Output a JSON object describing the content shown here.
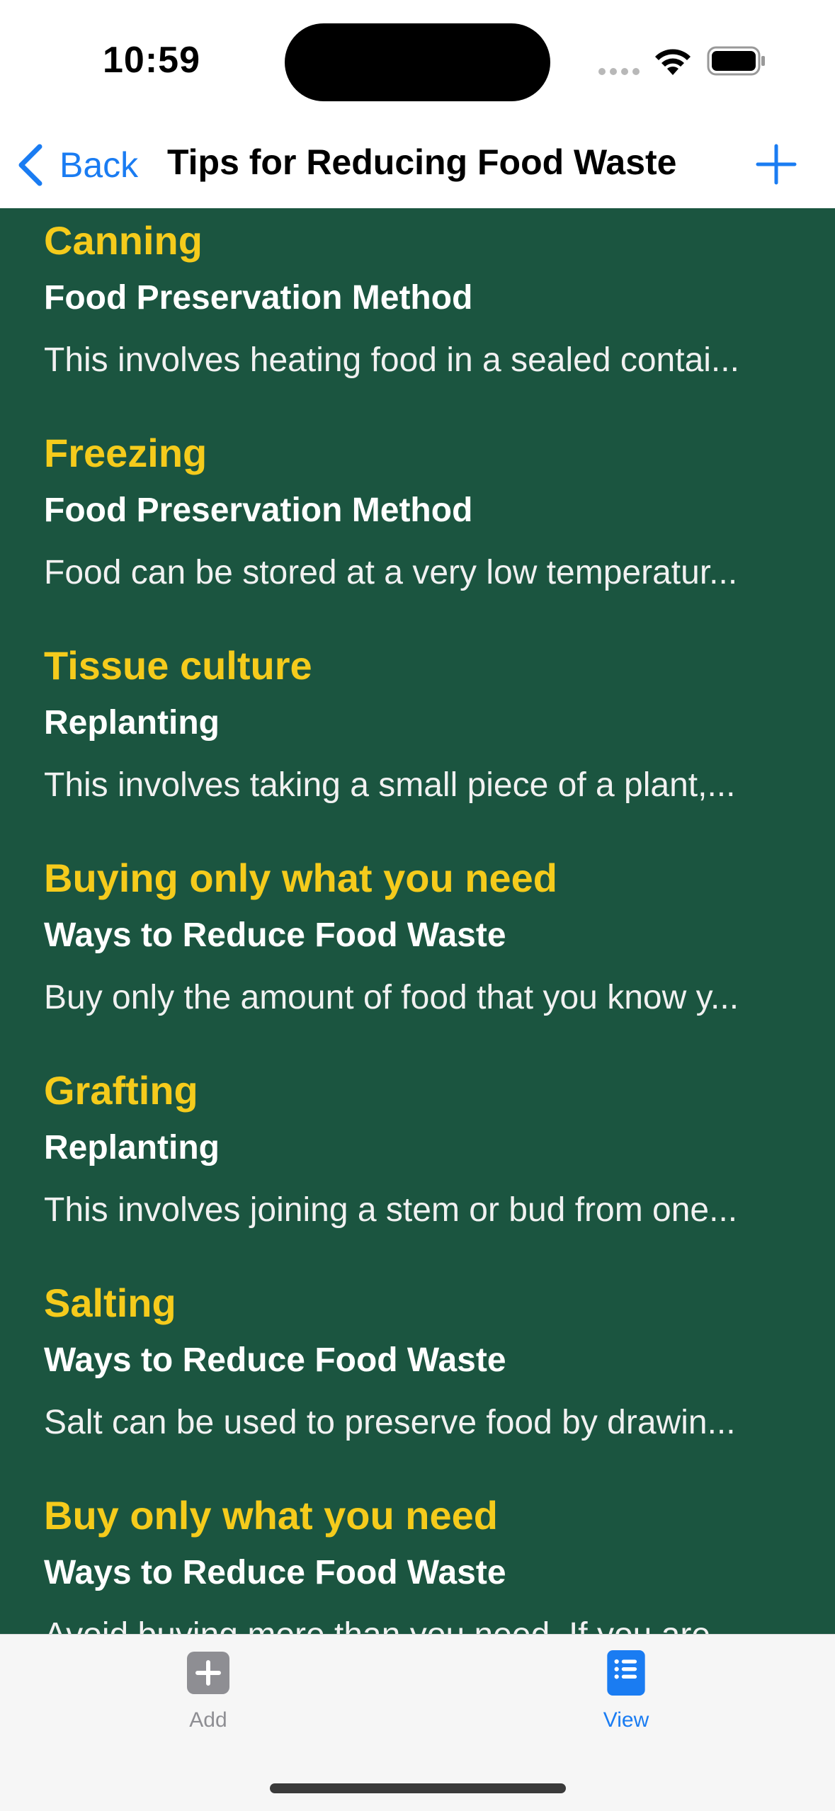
{
  "status_bar": {
    "time": "10:59"
  },
  "nav": {
    "back_label": "Back",
    "title": "Tips for Reducing Food Waste",
    "accent_color": "#1a7cf2"
  },
  "theme": {
    "background": "#1b5540",
    "title_color": "#f5cb1c",
    "text_color": "#ffffff"
  },
  "tips": [
    {
      "title": "Canning",
      "category": "Food Preservation Method",
      "description": "This involves heating food in a sealed contai..."
    },
    {
      "title": "Freezing",
      "category": "Food Preservation Method",
      "description": "Food can be stored at a very low temperatur..."
    },
    {
      "title": "Tissue culture",
      "category": "Replanting",
      "description": "This involves taking a small piece of a plant,..."
    },
    {
      "title": "Buying only what you need",
      "category": "Ways to Reduce Food Waste",
      "description": "Buy only the amount of food that you know y..."
    },
    {
      "title": "Grafting",
      "category": "Replanting",
      "description": "This involves joining a stem or bud from one..."
    },
    {
      "title": "Salting",
      "category": "Ways to Reduce Food Waste",
      "description": "Salt can be used to preserve food by drawin..."
    },
    {
      "title": "Buy only what you need",
      "category": "Ways to Reduce Food Waste",
      "description": "Avoid buying more than you need. If you are..."
    }
  ],
  "tab_bar": {
    "tabs": [
      {
        "label": "Add",
        "icon": "plus-square-icon",
        "selected": false
      },
      {
        "label": "View",
        "icon": "list-icon",
        "selected": true
      }
    ]
  }
}
